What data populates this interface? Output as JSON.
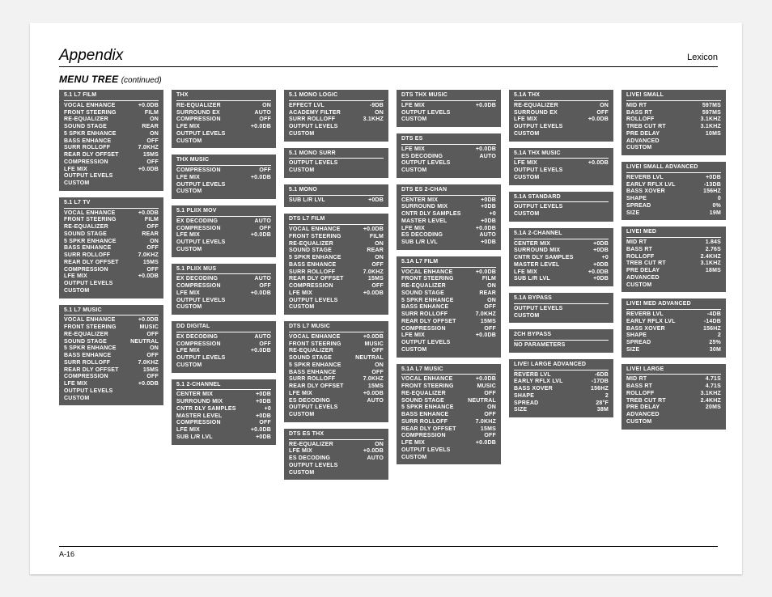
{
  "header": {
    "left": "Appendix",
    "right": "Lexicon"
  },
  "section": {
    "title": "MENU TREE",
    "cont": "(continued)"
  },
  "footer": {
    "page": "A-16"
  },
  "cols": [
    [
      {
        "title": "5.1 L7 FILM",
        "rows": [
          [
            "VOCAL ENHANCE",
            "+0.0dB"
          ],
          [
            "FRONT STEERING",
            "FILM"
          ],
          [
            "RE-EQUALIZER",
            "ON"
          ],
          [
            "SOUND STAGE",
            "REAR"
          ],
          [
            "5 SPKR ENHANCE",
            "ON"
          ],
          [
            "BASS ENHANCE",
            "OFF"
          ],
          [
            "SURR ROLLOFF",
            "7.0kHz"
          ],
          [
            "REAR DLY OFFSET",
            "15ms"
          ],
          [
            "COMPRESSION",
            "OFF"
          ],
          [
            "LFE MIX",
            "+0.0dB"
          ],
          [
            "OUTPUT LEVELS",
            ""
          ],
          [
            "CUSTOM",
            ""
          ]
        ]
      },
      {
        "title": "5.1 L7 TV",
        "rows": [
          [
            "VOCAL ENHANCE",
            "+0.0dB"
          ],
          [
            "FRONT STEERING",
            "FILM"
          ],
          [
            "RE-EQUALIZER",
            "OFF"
          ],
          [
            "SOUND STAGE",
            "REAR"
          ],
          [
            "5 SPKR ENHANCE",
            "ON"
          ],
          [
            "BASS ENHANCE",
            "OFF"
          ],
          [
            "SURR ROLLOFF",
            "7.0kHz"
          ],
          [
            "REAR DLY OFFSET",
            "15ms"
          ],
          [
            "COMPRESSION",
            "OFF"
          ],
          [
            "LFE MIX",
            "+0.0dB"
          ],
          [
            "OUTPUT LEVELS",
            ""
          ],
          [
            "CUSTOM",
            ""
          ]
        ]
      },
      {
        "title": "5.1 L7 MUSIC",
        "rows": [
          [
            "VOCAL ENHANCE",
            "+0.0dB"
          ],
          [
            "FRONT STEERING",
            "MUSIC"
          ],
          [
            "RE-EQUALIZER",
            "OFF"
          ],
          [
            "SOUND STAGE",
            "NEUTRAL"
          ],
          [
            "5 SPKR ENHANCE",
            "ON"
          ],
          [
            "BASS ENHANCE",
            "OFF"
          ],
          [
            "SURR ROLLOFF",
            "7.0kHz"
          ],
          [
            "REAR DLY OFFSET",
            "15ms"
          ],
          [
            "COMPRESSION",
            "OFF"
          ],
          [
            "LFE MIX",
            "+0.0dB"
          ],
          [
            "OUTPUT LEVELS",
            ""
          ],
          [
            "CUSTOM",
            ""
          ]
        ]
      }
    ],
    [
      {
        "title": "THX",
        "rows": [
          [
            "RE-EQUALIZER",
            "ON"
          ],
          [
            "SURROUND EX",
            "AUTO"
          ],
          [
            "COMPRESSION",
            "OFF"
          ],
          [
            "LFE MIX",
            "+0.0dB"
          ],
          [
            "OUTPUT LEVELS",
            ""
          ],
          [
            "CUSTOM",
            ""
          ]
        ]
      },
      {
        "title": "THX MUSIC",
        "rows": [
          [
            "COMPRESSION",
            "OFF"
          ],
          [
            "LFE MIX",
            "+0.0dB"
          ],
          [
            "OUTPUT LEVELS",
            ""
          ],
          [
            "CUSTOM",
            ""
          ]
        ]
      },
      {
        "title": "5.1 PLIIx MOV",
        "rows": [
          [
            "EX DECODING",
            "AUTO"
          ],
          [
            "COMPRESSION",
            "OFF"
          ],
          [
            "LFE MIX",
            "+0.0dB"
          ],
          [
            "OUTPUT LEVELS",
            ""
          ],
          [
            "CUSTOM",
            ""
          ]
        ]
      },
      {
        "title": "5.1 PLIIx MUS",
        "rows": [
          [
            "EX DECODING",
            "AUTO"
          ],
          [
            "COMPRESSION",
            "OFF"
          ],
          [
            "LFE MIX",
            "+0.0dB"
          ],
          [
            "OUTPUT LEVELS",
            ""
          ],
          [
            "CUSTOM",
            ""
          ]
        ]
      },
      {
        "title": "DD DIGITAL",
        "rows": [
          [
            "EX DECODING",
            "AUTO"
          ],
          [
            "COMPRESSION",
            "OFF"
          ],
          [
            "LFE MIX",
            "+0.0dB"
          ],
          [
            "OUTPUT LEVELS",
            ""
          ],
          [
            "CUSTOM",
            ""
          ]
        ]
      },
      {
        "title": "5.1 2-CHANNEL",
        "rows": [
          [
            "CENTER MIX",
            "+0dB"
          ],
          [
            "SURROUND MIX",
            "+0dB"
          ],
          [
            "CNTR DLY SAMPLES",
            "+0"
          ],
          [
            "MASTER LEVEL",
            "+0dB"
          ],
          [
            "COMPRESSION",
            "OFF"
          ],
          [
            "LFE MIX",
            "+0.0dB"
          ],
          [
            "SUB L/R LVL",
            "+0dB"
          ]
        ]
      }
    ],
    [
      {
        "title": "5.1 MONO LOGIC",
        "rows": [
          [
            "EFFECT LVL",
            "-9dB"
          ],
          [
            "ACADEMY FILTER",
            "ON"
          ],
          [
            "SURR ROLLOFF",
            "3.1kHz"
          ],
          [
            "OUTPUT LEVELS",
            ""
          ],
          [
            "CUSTOM",
            ""
          ]
        ]
      },
      {
        "title": "5.1 MONO SURR",
        "rows": [
          [
            "OUTPUT LEVELS",
            ""
          ],
          [
            "CUSTOM",
            ""
          ]
        ]
      },
      {
        "title": "5.1 MONO",
        "rows": [
          [
            "SUB L/R LVL",
            "+0dB"
          ]
        ]
      },
      {
        "title": "dts L7 FILM",
        "rows": [
          [
            "VOCAL ENHANCE",
            "+0.0dB"
          ],
          [
            "FRONT STEERING",
            "FILM"
          ],
          [
            "RE-EQUALIZER",
            "ON"
          ],
          [
            "SOUND STAGE",
            "REAR"
          ],
          [
            "5 SPKR ENHANCE",
            "ON"
          ],
          [
            "BASS ENHANCE",
            "OFF"
          ],
          [
            "SURR ROLLOFF",
            "7.0kHz"
          ],
          [
            "REAR DLY OFFSET",
            "15ms"
          ],
          [
            "COMPRESSION",
            "OFF"
          ],
          [
            "LFE MIX",
            "+0.0dB"
          ],
          [
            "OUTPUT LEVELS",
            ""
          ],
          [
            "CUSTOM",
            ""
          ]
        ]
      },
      {
        "title": "dts L7 MUSIC",
        "rows": [
          [
            "VOCAL ENHANCE",
            "+0.0dB"
          ],
          [
            "FRONT STEERING",
            "MUSIC"
          ],
          [
            "RE-EQUALIZER",
            "OFF"
          ],
          [
            "SOUND STAGE",
            "NEUTRAL"
          ],
          [
            "5 SPKR ENHANCE",
            "ON"
          ],
          [
            "BASS ENHANCE",
            "OFF"
          ],
          [
            "SURR ROLLOFF",
            "7.0kHz"
          ],
          [
            "REAR DLY OFFSET",
            "15ms"
          ],
          [
            "LFE MIX",
            "+0.0dB"
          ],
          [
            "ES DECODING",
            "AUTO"
          ],
          [
            "OUTPUT LEVELS",
            ""
          ],
          [
            "CUSTOM",
            ""
          ]
        ]
      },
      {
        "title": "dts ES THX",
        "rows": [
          [
            "RE-EQUALIZER",
            "ON"
          ],
          [
            "LFE MIX",
            "+0.0dB"
          ],
          [
            "ES DECODING",
            "AUTO"
          ],
          [
            "OUTPUT LEVELS",
            ""
          ],
          [
            "CUSTOM",
            ""
          ]
        ]
      }
    ],
    [
      {
        "title": "dts THX MUSIC",
        "rows": [
          [
            "LFE MIX",
            "+0.0dB"
          ],
          [
            "OUTPUT LEVELS",
            ""
          ],
          [
            "CUSTOM",
            ""
          ]
        ]
      },
      {
        "title": "dts ES",
        "rows": [
          [
            "LFE MIX",
            "+0.0dB"
          ],
          [
            "ES DECODING",
            "AUTO"
          ],
          [
            "OUTPUT LEVELS",
            ""
          ],
          [
            "CUSTOM",
            ""
          ]
        ]
      },
      {
        "title": "dts ES 2-CHAN",
        "rows": [
          [
            "CENTER MIX",
            "+0dB"
          ],
          [
            "SURROUND MIX",
            "+0dB"
          ],
          [
            "CNTR DLY SAMPLES",
            "+0"
          ],
          [
            "MASTER LEVEL",
            "+0dB"
          ],
          [
            "LFE MIX",
            "+0.0dB"
          ],
          [
            "ES DECODING",
            "AUTO"
          ],
          [
            "SUB L/R LVL",
            "+0dB"
          ]
        ]
      },
      {
        "title": "5.1a L7 FILM",
        "rows": [
          [
            "VOCAL ENHANCE",
            "+0.0dB"
          ],
          [
            "FRONT STEERING",
            "FILM"
          ],
          [
            "RE-EQUALIZER",
            "ON"
          ],
          [
            "SOUND STAGE",
            "REAR"
          ],
          [
            "5 SPKR ENHANCE",
            "ON"
          ],
          [
            "BASS ENHANCE",
            "OFF"
          ],
          [
            "SURR ROLLOFF",
            "7.0kHz"
          ],
          [
            "REAR DLY OFFSET",
            "15ms"
          ],
          [
            "COMPRESSION",
            "OFF"
          ],
          [
            "LFE MIX",
            "+0.0dB"
          ],
          [
            "OUTPUT LEVELS",
            ""
          ],
          [
            "CUSTOM",
            ""
          ]
        ]
      },
      {
        "title": "5.1a L7 MUSIC",
        "rows": [
          [
            "VOCAL ENHANCE",
            "+0.0dB"
          ],
          [
            "FRONT STEERING",
            "MUSIC"
          ],
          [
            "RE-EQUALIZER",
            "OFF"
          ],
          [
            "SOUND STAGE",
            "NEUTRAL"
          ],
          [
            "5 SPKR ENHANCE",
            "ON"
          ],
          [
            "BASS ENHANCE",
            "OFF"
          ],
          [
            "SURR ROLLOFF",
            "7.0kHz"
          ],
          [
            "REAR DLY OFFSET",
            "15ms"
          ],
          [
            "COMPRESSION",
            "OFF"
          ],
          [
            "LFE MIX",
            "+0.0dB"
          ],
          [
            "OUTPUT LEVELS",
            ""
          ],
          [
            "CUSTOM",
            ""
          ]
        ]
      }
    ],
    [
      {
        "title": "5.1a THX",
        "rows": [
          [
            "RE-EQUALIZER",
            "ON"
          ],
          [
            "SURROUND EX",
            "OFF"
          ],
          [
            "LFE MIX",
            "+0.0dB"
          ],
          [
            "OUTPUT LEVELS",
            ""
          ],
          [
            "CUSTOM",
            ""
          ]
        ]
      },
      {
        "title": "5.1a THX MUSIC",
        "rows": [
          [
            "LFE MIX",
            "+0.0dB"
          ],
          [
            "OUTPUT LEVELS",
            ""
          ],
          [
            "CUSTOM",
            ""
          ]
        ]
      },
      {
        "title": "5.1a STANDARD",
        "rows": [
          [
            "OUTPUT LEVELS",
            ""
          ],
          [
            "CUSTOM",
            ""
          ]
        ]
      },
      {
        "title": "5.1a 2-CHANNEL",
        "rows": [
          [
            "CENTER MIX",
            "+0dB"
          ],
          [
            "SURROUND MIX",
            "+0dB"
          ],
          [
            "CNTR DLY SAMPLES",
            "+0"
          ],
          [
            "MASTER LEVEL",
            "+0dB"
          ],
          [
            "LFE MIX",
            "+0.0dB"
          ],
          [
            "SUB L/R LVL",
            "+0dB"
          ]
        ]
      },
      {
        "title": "5.1a BYPASS",
        "rows": [
          [
            "OUTPUT LEVELS",
            ""
          ],
          [
            "CUSTOM",
            ""
          ]
        ]
      },
      {
        "title": "2CH BYPASS",
        "rows": [
          [
            "NO PARAMETERS",
            ""
          ]
        ]
      },
      {
        "title": "LIVE! LARGE ADVANCED",
        "rows": [
          [
            "REVERB LVL",
            "-6dB"
          ],
          [
            "EARLY RFLX LVL",
            "-17dB"
          ],
          [
            "BASS XOVER",
            "156Hz"
          ],
          [
            "SHAPE",
            "2"
          ],
          [
            "SPREAD",
            "28°F"
          ],
          [
            "SIZE",
            "38m"
          ]
        ]
      }
    ],
    [
      {
        "title": "LIVE! SMALL",
        "rows": [
          [
            "MID RT",
            "597ms"
          ],
          [
            "BASS RT",
            "597ms"
          ],
          [
            "ROLLOFF",
            "3.1kHz"
          ],
          [
            "TREB CUT RT",
            "3.1kHz"
          ],
          [
            "PRE DELAY",
            "10ms"
          ],
          [
            "ADVANCED",
            ""
          ],
          [
            "CUSTOM",
            ""
          ]
        ]
      },
      {
        "title": "LIVE! SMALL ADVANCED",
        "rows": [
          [
            "REVERB LVL",
            "+0dB"
          ],
          [
            "EARLY RFLX LVL",
            "-13dB"
          ],
          [
            "BASS XOVER",
            "156Hz"
          ],
          [
            "SHAPE",
            "0"
          ],
          [
            "SPREAD",
            "0%"
          ],
          [
            "SIZE",
            "19m"
          ]
        ]
      },
      {
        "title": "LIVE! MED",
        "rows": [
          [
            "MID RT",
            "1.84s"
          ],
          [
            "BASS RT",
            "2.76s"
          ],
          [
            "ROLLOFF",
            "2.4kHz"
          ],
          [
            "TREB CUT RT",
            "3.1kHz"
          ],
          [
            "PRE DELAY",
            "18ms"
          ],
          [
            "ADVANCED",
            ""
          ],
          [
            "CUSTOM",
            ""
          ]
        ]
      },
      {
        "title": "LIVE! MED ADVANCED",
        "rows": [
          [
            "REVERB LVL",
            "-4dB"
          ],
          [
            "EARLY RFLX LVL",
            "-14dB"
          ],
          [
            "BASS XOVER",
            "156Hz"
          ],
          [
            "SHAPE",
            "2"
          ],
          [
            "SPREAD",
            "25%"
          ],
          [
            "SIZE",
            "30m"
          ]
        ]
      },
      {
        "title": "LIVE! LARGE",
        "rows": [
          [
            "MID RT",
            "4.71s"
          ],
          [
            "BASS RT",
            "4.71s"
          ],
          [
            "ROLLOFF",
            "3.1kHz"
          ],
          [
            "TREB CUT RT",
            "2.4kHz"
          ],
          [
            "PRE DELAY",
            "20ms"
          ],
          [
            "ADVANCED",
            ""
          ],
          [
            "CUSTOM",
            ""
          ]
        ]
      }
    ]
  ]
}
